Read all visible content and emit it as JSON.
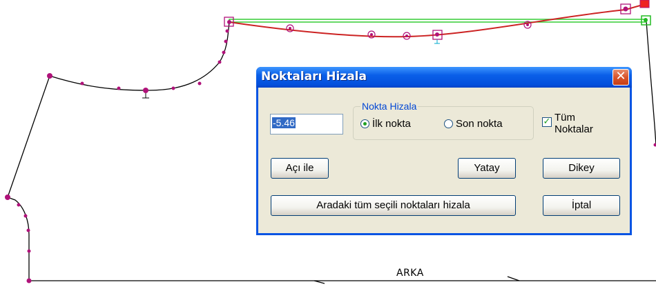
{
  "canvas": {
    "pattern_label": "ARKA",
    "colors": {
      "outline": "#000000",
      "selected_curve": "#cc2222",
      "alignment_line": "#33cc33",
      "points": "#b0127a"
    }
  },
  "dialog": {
    "title": "Noktaları Hizala",
    "close_icon": "close-icon",
    "value_input": "-5.46",
    "group_label": "Nokta Hizala",
    "radio_first": "İlk nokta",
    "radio_last": "Son nokta",
    "radio_selected": "first",
    "checkbox_all_line1": "Tüm",
    "checkbox_all_line2": "Noktalar",
    "checkbox_all_checked": true,
    "btn_angle": "Açı ile",
    "btn_horizontal": "Yatay",
    "btn_vertical": "Dikey",
    "btn_align_all": "Aradaki tüm seçili noktaları hizala",
    "btn_cancel": "İptal"
  }
}
